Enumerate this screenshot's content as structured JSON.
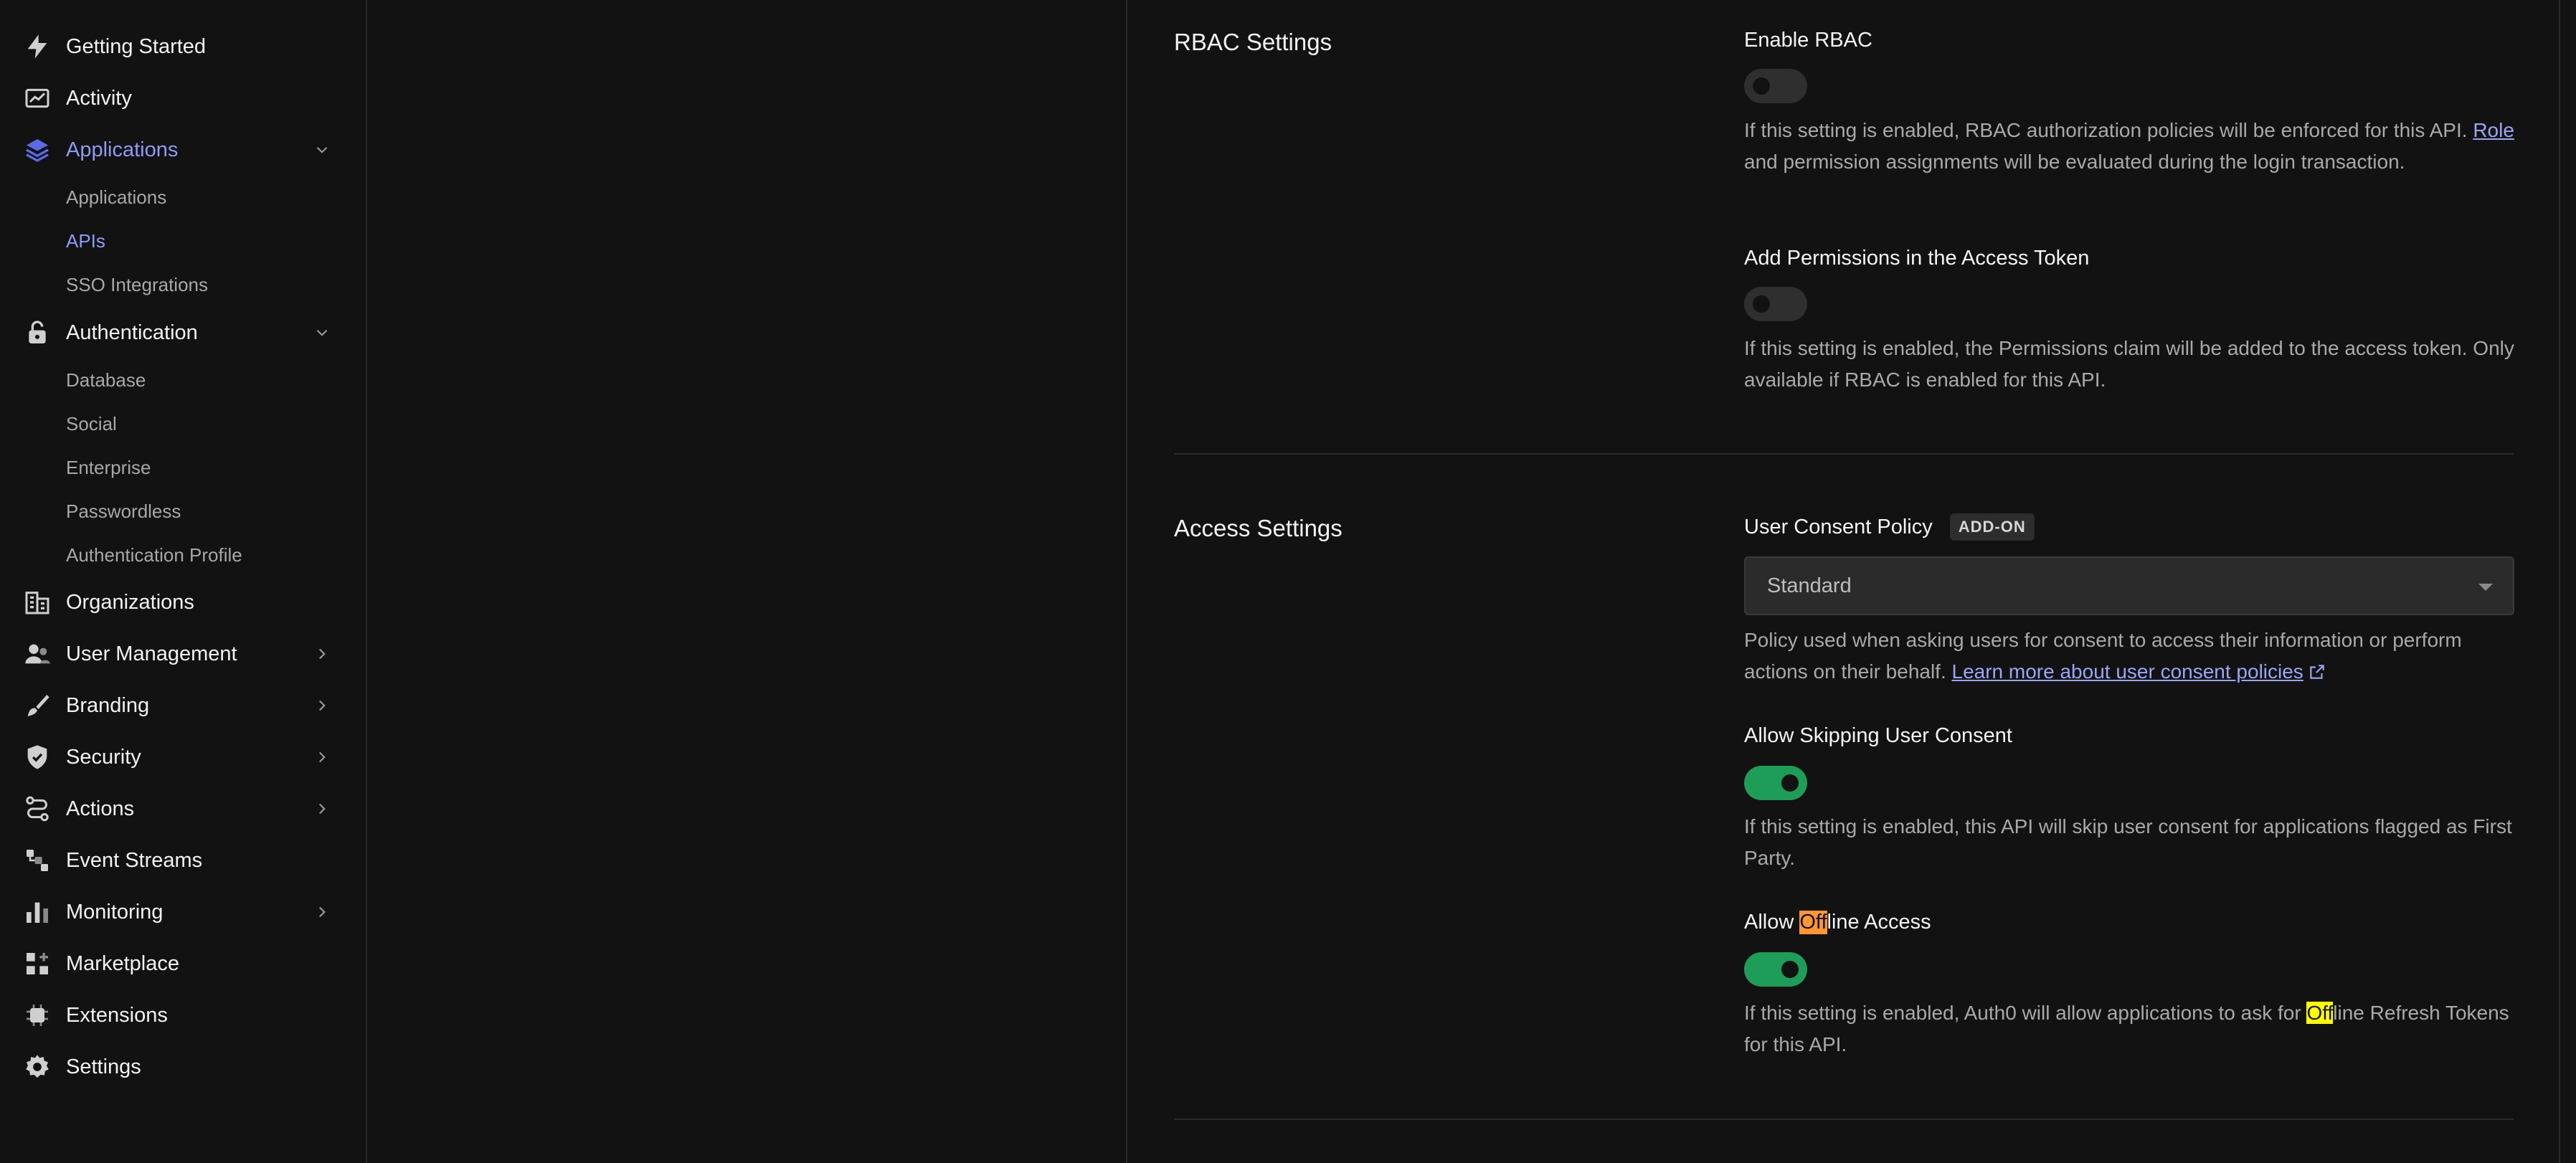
{
  "sidebar": {
    "items": [
      {
        "id": "getting-started",
        "label": "Getting Started",
        "icon": "bolt-icon"
      },
      {
        "id": "activity",
        "label": "Activity",
        "icon": "chart-line-icon"
      },
      {
        "id": "applications",
        "label": "Applications",
        "icon": "layers-icon",
        "expanded": true,
        "active": true
      },
      {
        "id": "authentication",
        "label": "Authentication",
        "icon": "lock-icon",
        "expanded": true
      },
      {
        "id": "organizations",
        "label": "Organizations",
        "icon": "building-icon"
      },
      {
        "id": "user-management",
        "label": "User Management",
        "icon": "users-icon"
      },
      {
        "id": "branding",
        "label": "Branding",
        "icon": "brush-icon"
      },
      {
        "id": "security",
        "label": "Security",
        "icon": "shield-icon"
      },
      {
        "id": "actions",
        "label": "Actions",
        "icon": "flow-icon"
      },
      {
        "id": "event-streams",
        "label": "Event Streams",
        "icon": "stream-icon"
      },
      {
        "id": "monitoring",
        "label": "Monitoring",
        "icon": "bar-chart-icon"
      },
      {
        "id": "marketplace",
        "label": "Marketplace",
        "icon": "grid-plus-icon"
      },
      {
        "id": "extensions",
        "label": "Extensions",
        "icon": "chip-icon"
      },
      {
        "id": "settings",
        "label": "Settings",
        "icon": "gear-icon"
      }
    ],
    "applications_sub": [
      "Applications",
      "APIs",
      "SSO Integrations"
    ],
    "authentication_sub": [
      "Database",
      "Social",
      "Enterprise",
      "Passwordless",
      "Authentication Profile"
    ],
    "active_sub": "APIs"
  },
  "rbac": {
    "section_title": "RBAC Settings",
    "enable_label": "Enable RBAC",
    "enable_on": false,
    "enable_desc_1": "If this setting is enabled, RBAC authorization policies will be enforced for this API. ",
    "enable_desc_link": "Role",
    "enable_desc_2": " and permission assignments will be evaluated during the login transaction.",
    "perms_label": "Add Permissions in the Access Token",
    "perms_on": false,
    "perms_desc": "If this setting is enabled, the Permissions claim will be added to the access token. Only available if RBAC is enabled for this API."
  },
  "access": {
    "section_title": "Access Settings",
    "consent_label": "User Consent Policy",
    "consent_badge": "ADD-ON",
    "consent_value": "Standard",
    "consent_desc": "Policy used when asking users for consent to access their information or perform actions on their behalf. ",
    "consent_link": "Learn more about user consent policies",
    "skip_label": "Allow Skipping User Consent",
    "skip_on": true,
    "skip_desc": "If this setting is enabled, this API will skip user consent for applications flagged as First Party.",
    "offline_label_pre": "Allow ",
    "offline_label_hl": "Off",
    "offline_label_post": "line Access",
    "offline_on": true,
    "offline_desc_pre": "If this setting is enabled, Auth0 will allow applications to ask for ",
    "offline_desc_hl": "Off",
    "offline_desc_post": "line Refresh Tokens for this API."
  },
  "colors": {
    "accent": "#8f9bf5",
    "toggle_on": "#1d9d57",
    "highlight_orange": "#ff9632",
    "highlight_yellow": "#ffff00"
  }
}
